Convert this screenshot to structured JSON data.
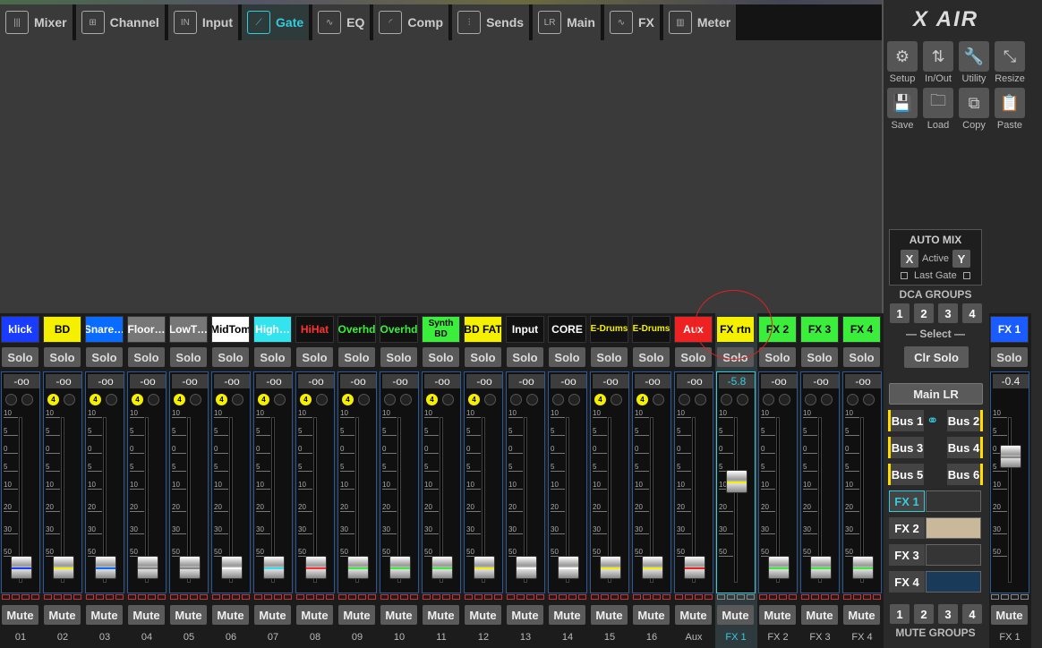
{
  "tabs": [
    {
      "label": "Mixer",
      "icon": "mixer-icon"
    },
    {
      "label": "Channel",
      "icon": "channel-icon"
    },
    {
      "label": "Input",
      "icon": "input-icon"
    },
    {
      "label": "Gate",
      "icon": "gate-icon",
      "active": true
    },
    {
      "label": "EQ",
      "icon": "eq-icon"
    },
    {
      "label": "Comp",
      "icon": "comp-icon"
    },
    {
      "label": "Sends",
      "icon": "sends-icon"
    },
    {
      "label": "Main",
      "icon": "main-icon"
    },
    {
      "label": "FX",
      "icon": "fx-icon"
    },
    {
      "label": "Meter",
      "icon": "meter-icon"
    }
  ],
  "logo": "X AIR",
  "utility": [
    {
      "label": "Setup",
      "icon": "gear-icon"
    },
    {
      "label": "In/Out",
      "icon": "arrows-icon"
    },
    {
      "label": "Utility",
      "icon": "wrench-icon"
    },
    {
      "label": "Resize",
      "icon": "resize-icon"
    },
    {
      "label": "Save",
      "icon": "save-icon"
    },
    {
      "label": "Load",
      "icon": "folder-icon"
    },
    {
      "label": "Copy",
      "icon": "copy-icon"
    },
    {
      "label": "Paste",
      "icon": "paste-icon"
    }
  ],
  "automix": {
    "title": "AUTO MIX",
    "x": "X",
    "active": "Active",
    "y": "Y",
    "last_gate": "Last Gate"
  },
  "dca": {
    "title": "DCA GROUPS",
    "buttons": [
      "1",
      "2",
      "3",
      "4"
    ],
    "select": "Select",
    "clr_solo": "Clr Solo"
  },
  "main_lr": "Main LR",
  "buses": [
    "Bus 1",
    "Bus 2",
    "Bus 3",
    "Bus 4",
    "Bus 5",
    "Bus 6"
  ],
  "fx_buttons": [
    "FX 1",
    "FX 2",
    "FX 3",
    "FX 4"
  ],
  "mute_groups": {
    "title": "MUTE GROUPS",
    "buttons": [
      "1",
      "2",
      "3",
      "4"
    ]
  },
  "solo_label": "Solo",
  "mute_label": "Mute",
  "channels": [
    {
      "name": "klick",
      "num": "01",
      "db": "-oo",
      "bg": "#1a3cff",
      "fg": "#fff",
      "line": "#1a3cff"
    },
    {
      "name": "BD",
      "num": "02",
      "db": "-oo",
      "bg": "#f4f000",
      "fg": "#000",
      "badge": "4",
      "line": "#f4f000"
    },
    {
      "name": "Snare…",
      "num": "03",
      "db": "-oo",
      "bg": "#0a6cff",
      "fg": "#fff",
      "badge": "4",
      "line": "#0a6cff"
    },
    {
      "name": "Floor…",
      "num": "04",
      "db": "-oo",
      "bg": "#777",
      "fg": "#fff",
      "badge": "4",
      "line": "#888"
    },
    {
      "name": "LowT…",
      "num": "05",
      "db": "-oo",
      "bg": "#777",
      "fg": "#fff",
      "badge": "4",
      "line": "#888"
    },
    {
      "name": "MidTom",
      "num": "06",
      "db": "-oo",
      "bg": "#fff",
      "fg": "#000",
      "badge": "4",
      "line": "#fff"
    },
    {
      "name": "High…",
      "num": "07",
      "db": "-oo",
      "bg": "#33e3ee",
      "fg": "#fff",
      "badge": "4",
      "line": "#33e3ee"
    },
    {
      "name": "HiHat",
      "num": "08",
      "db": "-oo",
      "bg": "#111",
      "fg": "#ff3030",
      "badge": "4",
      "line": "#ff3030"
    },
    {
      "name": "Overhd",
      "num": "09",
      "db": "-oo",
      "bg": "#111",
      "fg": "#3cee3c",
      "badge": "4",
      "line": "#3cee3c"
    },
    {
      "name": "Overhd",
      "num": "10",
      "db": "-oo",
      "bg": "#111",
      "fg": "#3cee3c",
      "line": "#3cee3c"
    },
    {
      "name": "Synth BD",
      "num": "11",
      "db": "-oo",
      "bg": "#3cee3c",
      "fg": "#000",
      "badge": "4",
      "line": "#3cee3c"
    },
    {
      "name": "BD FAT",
      "num": "12",
      "db": "-oo",
      "bg": "#f4f000",
      "fg": "#000",
      "badge": "4",
      "line": "#f4f000"
    },
    {
      "name": "Input",
      "num": "13",
      "db": "-oo",
      "bg": "#111",
      "fg": "#fff",
      "line": "#fff"
    },
    {
      "name": "CORE",
      "num": "14",
      "db": "-oo",
      "bg": "#111",
      "fg": "#fff",
      "line": "#fff"
    },
    {
      "name": "E-Drums",
      "num": "15",
      "db": "-oo",
      "bg": "#111",
      "fg": "#f4f000",
      "badge": "4",
      "line": "#f4f000"
    },
    {
      "name": "E-Drums",
      "num": "16",
      "db": "-oo",
      "bg": "#111",
      "fg": "#f4f000",
      "badge": "4",
      "line": "#f4f000"
    },
    {
      "name": "Aux",
      "num": "Aux",
      "db": "-oo",
      "bg": "#ee2222",
      "fg": "#fff",
      "line": "#ee2222"
    },
    {
      "name": "FX rtn",
      "num": "FX 1",
      "db": "-5.8",
      "bg": "#f4f000",
      "fg": "#000",
      "line": "#f4f000",
      "selected": true,
      "level": 0.62
    },
    {
      "name": "FX 2",
      "num": "FX 2",
      "db": "-oo",
      "bg": "#3cee3c",
      "fg": "#000",
      "line": "#3cee3c"
    },
    {
      "name": "FX 3",
      "num": "FX 3",
      "db": "-oo",
      "bg": "#3cee3c",
      "fg": "#000",
      "line": "#3cee3c"
    },
    {
      "name": "FX 4",
      "num": "FX 4",
      "db": "-oo",
      "bg": "#3cee3c",
      "fg": "#000",
      "line": "#3cee3c"
    }
  ],
  "master": {
    "name": "FX 1",
    "num": "FX 1",
    "db": "-0.4",
    "bg": "#1a5cff",
    "fg": "#fff",
    "level": 0.8
  },
  "scale_labels": [
    "10",
    "5",
    "0",
    "5",
    "10",
    "20",
    "30",
    "50"
  ]
}
